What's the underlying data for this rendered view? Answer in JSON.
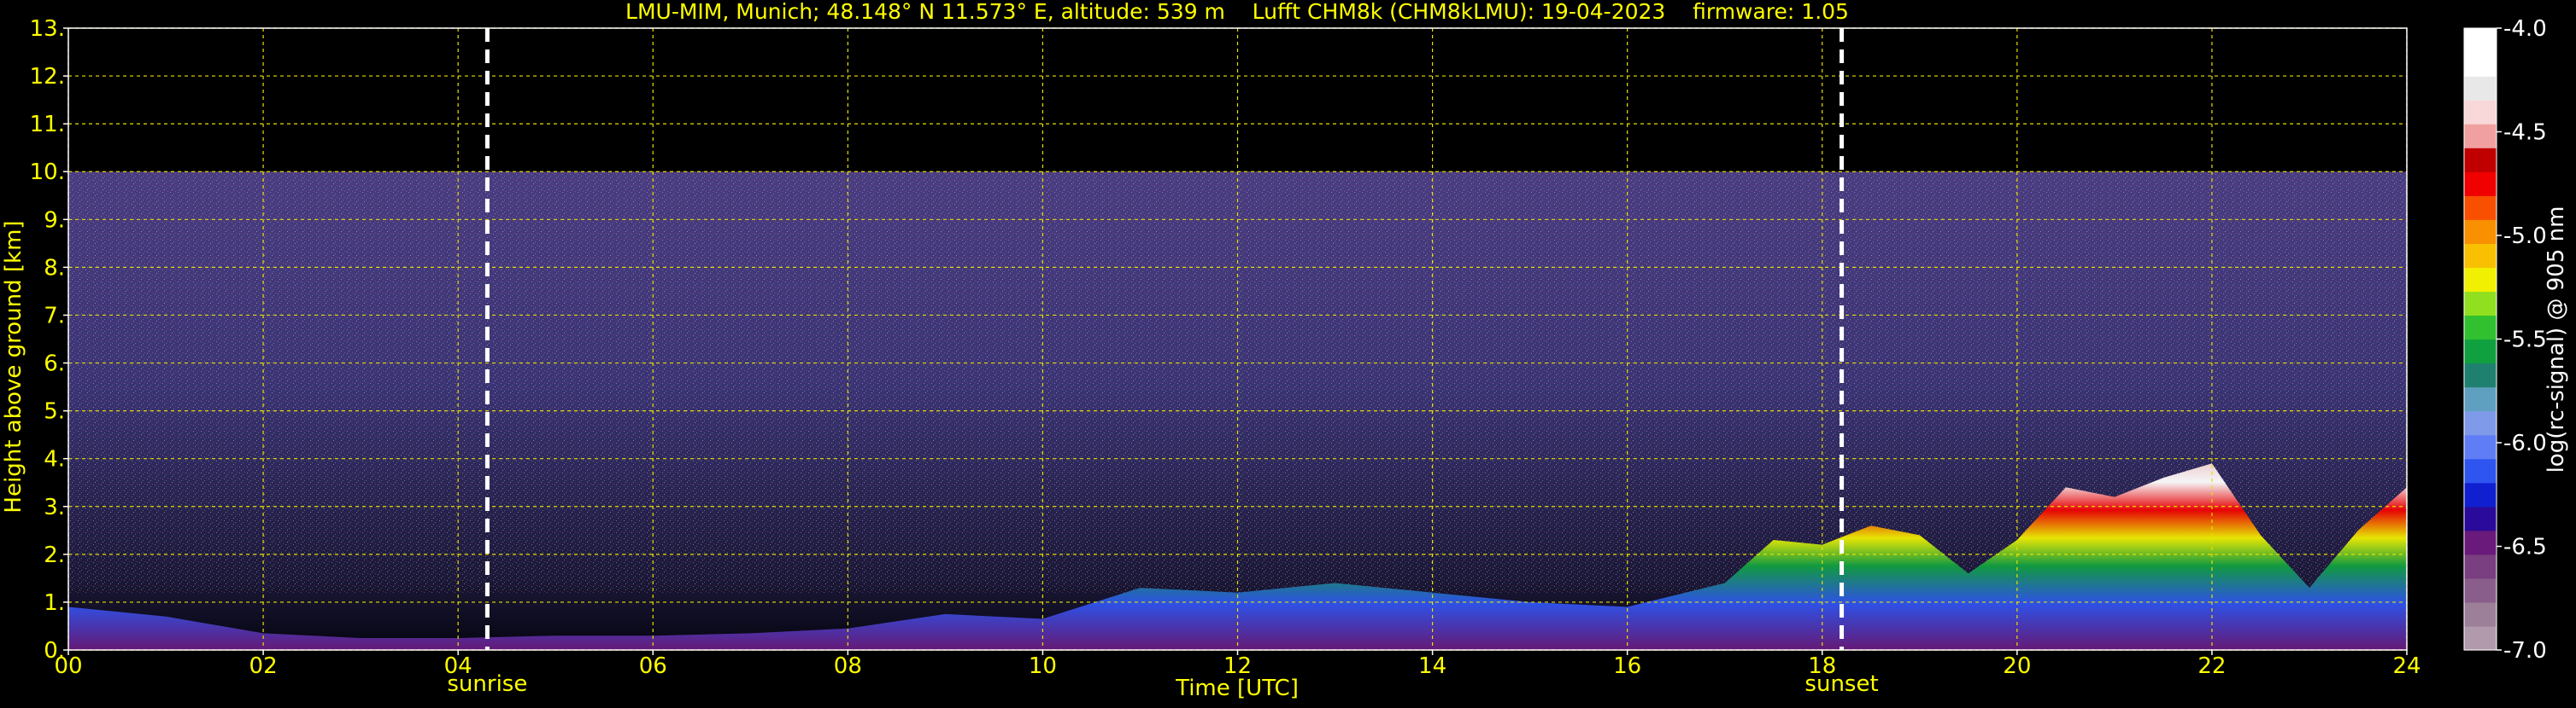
{
  "chart_data": {
    "type": "heatmap",
    "title": "LMU-MIM, Munich; 48.148° N 11.573° E, altitude: 539 m    Lufft CHM8k (CHM8kLMU): 19-04-2023    firmware: 1.05",
    "xlabel": "Time [UTC]",
    "ylabel": "Height above ground [km]",
    "xlim": [
      0,
      24
    ],
    "ylim": [
      0,
      13
    ],
    "x_ticks": [
      "00",
      "02",
      "04",
      "06",
      "08",
      "10",
      "12",
      "14",
      "16",
      "18",
      "20",
      "22",
      "24"
    ],
    "y_ticks": [
      "0.",
      "1.",
      "2.",
      "3.",
      "4.",
      "5.",
      "6.",
      "7.",
      "8.",
      "9.",
      "10.",
      "11.",
      "12.",
      "13."
    ],
    "grid": true,
    "colorbar": {
      "label": "log(rc-signal) @ 905 nm",
      "range": [
        -7.0,
        -4.0
      ],
      "ticks": [
        "-4.0",
        "-4.5",
        "-5.0",
        "-5.5",
        "-6.0",
        "-6.5",
        "-7.0"
      ],
      "colors": [
        "#b09aac",
        "#9c7f98",
        "#8a5e8a",
        "#7a3f80",
        "#6a1a7a",
        "#2a0a9a",
        "#1020d0",
        "#2f55f0",
        "#5f7ef5",
        "#7f9ae8",
        "#5fa0c0",
        "#208070",
        "#10a040",
        "#30c030",
        "#90e020",
        "#f0f000",
        "#f8c000",
        "#f89000",
        "#f85000",
        "#f00000",
        "#c00000",
        "#f0a0a0",
        "#f8d8d8",
        "#e8e8e8",
        "#ffffff",
        "#ffffff"
      ]
    },
    "markers": [
      {
        "time": 4.3,
        "label": "sunrise"
      },
      {
        "time": 18.2,
        "label": "sunset"
      }
    ],
    "data_top_km": 10.0,
    "boundary_layer": [
      {
        "t": 0.0,
        "base": 0.0,
        "top": 0.9
      },
      {
        "t": 1.0,
        "base": 0.0,
        "top": 0.7
      },
      {
        "t": 2.0,
        "base": 0.0,
        "top": 0.35
      },
      {
        "t": 3.0,
        "base": 0.0,
        "top": 0.25
      },
      {
        "t": 4.0,
        "base": 0.0,
        "top": 0.25
      },
      {
        "t": 5.0,
        "base": 0.0,
        "top": 0.3
      },
      {
        "t": 6.0,
        "base": 0.0,
        "top": 0.3
      },
      {
        "t": 7.0,
        "base": 0.0,
        "top": 0.35
      },
      {
        "t": 8.0,
        "base": 0.0,
        "top": 0.45
      },
      {
        "t": 9.0,
        "base": 0.0,
        "top": 0.75
      },
      {
        "t": 10.0,
        "base": 0.0,
        "top": 0.65
      },
      {
        "t": 11.0,
        "base": 0.0,
        "top": 1.3
      },
      {
        "t": 12.0,
        "base": 0.0,
        "top": 1.2
      },
      {
        "t": 13.0,
        "base": 0.0,
        "top": 1.4
      },
      {
        "t": 14.0,
        "base": 0.0,
        "top": 1.2
      },
      {
        "t": 15.0,
        "base": 0.0,
        "top": 1.0
      },
      {
        "t": 16.0,
        "base": 0.0,
        "top": 0.9
      },
      {
        "t": 17.0,
        "base": 0.0,
        "top": 1.4
      },
      {
        "t": 17.5,
        "base": 0.0,
        "top": 2.3
      },
      {
        "t": 18.0,
        "base": 0.0,
        "top": 2.2
      },
      {
        "t": 18.5,
        "base": 0.0,
        "top": 2.6
      },
      {
        "t": 19.0,
        "base": 0.0,
        "top": 2.4
      },
      {
        "t": 19.5,
        "base": 0.0,
        "top": 1.6
      },
      {
        "t": 20.0,
        "base": 0.0,
        "top": 2.3
      },
      {
        "t": 20.5,
        "base": 0.0,
        "top": 3.4
      },
      {
        "t": 21.0,
        "base": 0.0,
        "top": 3.2
      },
      {
        "t": 21.5,
        "base": 0.0,
        "top": 3.6
      },
      {
        "t": 22.0,
        "base": 0.0,
        "top": 3.9
      },
      {
        "t": 22.5,
        "base": 0.0,
        "top": 2.4
      },
      {
        "t": 23.0,
        "base": 0.0,
        "top": 1.3
      },
      {
        "t": 23.5,
        "base": 0.0,
        "top": 2.5
      },
      {
        "t": 24.0,
        "base": 0.0,
        "top": 3.4
      }
    ]
  }
}
